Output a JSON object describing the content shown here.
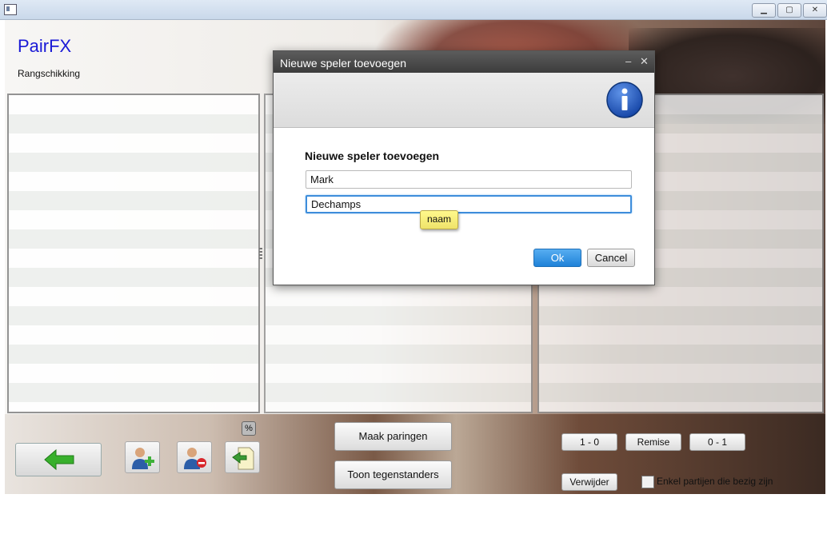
{
  "window": {
    "title": "",
    "controls": [
      "minimize",
      "maximize",
      "close"
    ]
  },
  "app": {
    "brand": "PairFX",
    "section": "Rangschikking"
  },
  "toolbar": {
    "percent_badge": "%",
    "make_pairings_label": "Maak paringen",
    "show_opponents_label": "Toon tegenstanders",
    "result_win_label": "1 - 0",
    "result_draw_label": "Remise",
    "result_loss_label": "0 - 1",
    "delete_label": "Verwijder",
    "only_active_games_label": "Enkel partijen die bezig zijn",
    "only_active_games_checked": false
  },
  "dialog": {
    "title": "Nieuwe speler toevoegen",
    "minimize_glyph": "‒",
    "close_glyph": "✕",
    "icon": "info-icon",
    "body_title": "Nieuwe speler toevoegen",
    "first_name_value": "Mark",
    "last_name_value": "Dechamps",
    "tooltip": "naam",
    "ok_label": "Ok",
    "cancel_label": "Cancel"
  },
  "colors": {
    "brand": "#1a1ad6",
    "ok_button": "#1f82d8",
    "focus_ring": "#3d8ddb",
    "tooltip_bg": "#fff98c"
  }
}
